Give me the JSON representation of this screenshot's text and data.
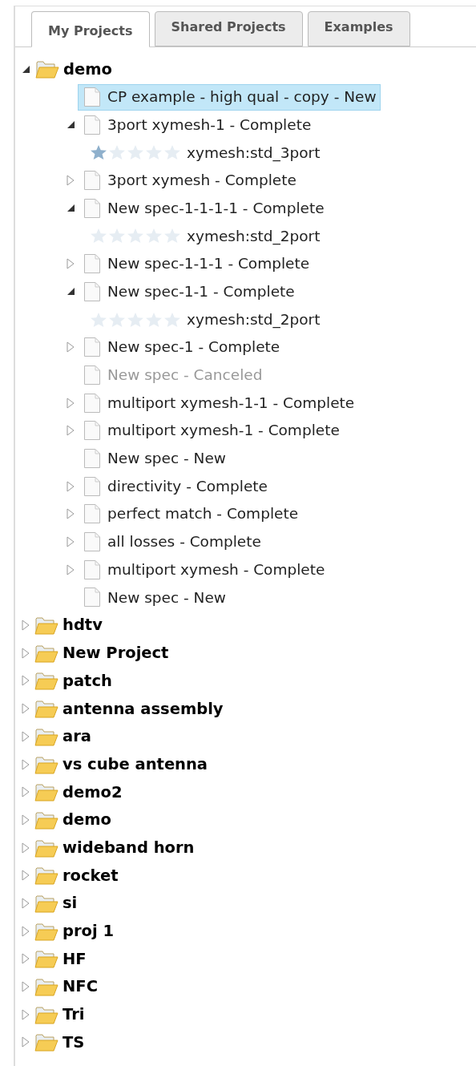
{
  "tabs": [
    {
      "label": "My Projects",
      "selected": true
    },
    {
      "label": "Shared Projects",
      "selected": false
    },
    {
      "label": "Examples",
      "selected": false
    }
  ],
  "projects": [
    {
      "name": "demo",
      "expanded": true,
      "children": [
        {
          "label": "CP example - high qual - copy - New",
          "kind": "leaf",
          "selected": true,
          "disabled": false
        },
        {
          "label": "3port xymesh-1 - Complete",
          "kind": "branch",
          "expanded": true,
          "selected": false,
          "disabled": false,
          "children": [
            {
              "label": "xymesh:std_3port",
              "stars": 1
            }
          ]
        },
        {
          "label": "3port xymesh - Complete",
          "kind": "branch",
          "expanded": false,
          "selected": false,
          "disabled": false
        },
        {
          "label": "New spec-1-1-1-1 - Complete",
          "kind": "branch",
          "expanded": true,
          "selected": false,
          "disabled": false,
          "children": [
            {
              "label": "xymesh:std_2port",
              "stars": 0
            }
          ]
        },
        {
          "label": "New spec-1-1-1 - Complete",
          "kind": "branch",
          "expanded": false,
          "selected": false,
          "disabled": false
        },
        {
          "label": "New spec-1-1 - Complete",
          "kind": "branch",
          "expanded": true,
          "selected": false,
          "disabled": false,
          "children": [
            {
              "label": "xymesh:std_2port",
              "stars": 0
            }
          ]
        },
        {
          "label": "New spec-1 - Complete",
          "kind": "branch",
          "expanded": false,
          "selected": false,
          "disabled": false
        },
        {
          "label": "New spec - Canceled",
          "kind": "leaf",
          "selected": false,
          "disabled": true
        },
        {
          "label": "multiport xymesh-1-1 - Complete",
          "kind": "branch",
          "expanded": false,
          "selected": false,
          "disabled": false
        },
        {
          "label": "multiport xymesh-1 - Complete",
          "kind": "branch",
          "expanded": false,
          "selected": false,
          "disabled": false
        },
        {
          "label": "New spec - New",
          "kind": "leaf",
          "selected": false,
          "disabled": false
        },
        {
          "label": "directivity - Complete",
          "kind": "branch",
          "expanded": false,
          "selected": false,
          "disabled": false
        },
        {
          "label": "perfect match - Complete",
          "kind": "branch",
          "expanded": false,
          "selected": false,
          "disabled": false
        },
        {
          "label": "all losses - Complete",
          "kind": "branch",
          "expanded": false,
          "selected": false,
          "disabled": false
        },
        {
          "label": "multiport xymesh - Complete",
          "kind": "branch",
          "expanded": false,
          "selected": false,
          "disabled": false
        },
        {
          "label": "New spec - New",
          "kind": "leaf",
          "selected": false,
          "disabled": false
        }
      ]
    },
    {
      "name": "hdtv",
      "expanded": false
    },
    {
      "name": "New Project",
      "expanded": false
    },
    {
      "name": "patch",
      "expanded": false
    },
    {
      "name": "antenna assembly",
      "expanded": false
    },
    {
      "name": "ara",
      "expanded": false
    },
    {
      "name": "vs cube antenna",
      "expanded": false
    },
    {
      "name": "demo2",
      "expanded": false
    },
    {
      "name": "demo",
      "expanded": false
    },
    {
      "name": "wideband horn",
      "expanded": false
    },
    {
      "name": "rocket",
      "expanded": false
    },
    {
      "name": "si",
      "expanded": false
    },
    {
      "name": "proj 1",
      "expanded": false
    },
    {
      "name": "HF",
      "expanded": false
    },
    {
      "name": "NFC",
      "expanded": false
    },
    {
      "name": "Tri",
      "expanded": false
    },
    {
      "name": "TS",
      "expanded": false
    }
  ]
}
